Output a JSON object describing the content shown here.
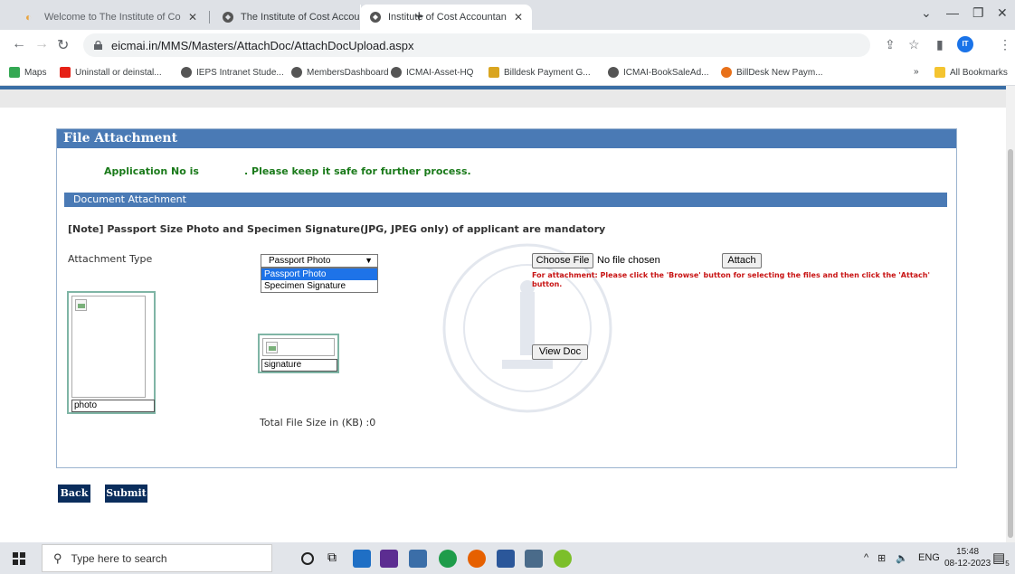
{
  "browser": {
    "tabs": [
      {
        "title": "Welcome to The Institute of Cos"
      },
      {
        "title": "The Institute of Cost Accountant"
      },
      {
        "title": "Institute of Cost Accountants of"
      }
    ],
    "address": "eicmai.in/MMS/Masters/AttachDoc/AttachDocUpload.aspx",
    "profile_initials": "IT",
    "bookmarks": [
      "Maps",
      "Uninstall or deinstal...",
      "IEPS Intranet Stude...",
      "MembersDashboard",
      "ICMAI-Asset-HQ",
      "Billdesk Payment G...",
      "ICMAI-BookSaleAd...",
      "BillDesk New Paym...",
      "All Bookmarks"
    ],
    "overflow": "»"
  },
  "page": {
    "header": "File Attachment",
    "app_no_label": "Application No is",
    "app_no_message": ". Please keep it safe for further process.",
    "section": "Document Attachment",
    "note": "[Note] Passport Size Photo and Specimen Signature(JPG, JPEG only) of applicant are mandatory",
    "attachment_type_label": "Attachment Type",
    "select_value": "Passport Photo",
    "options": [
      "Passport Photo",
      "Specimen Signature"
    ],
    "choose_file": "Choose File",
    "no_file": "No file chosen",
    "attach": "Attach",
    "hint": "For attachment: Please click the 'Browse' button for selecting the files and then click the 'Attach' button.",
    "photo_label": "photo",
    "signature_label": "signature",
    "view_doc": "View Doc",
    "total_size": "Total File Size in (KB) :0",
    "back": "Back",
    "submit": "Submit"
  },
  "taskbar": {
    "search_placeholder": "Type here to search",
    "lang": "ENG",
    "time": "15:48",
    "date": "08-12-2023",
    "notif_count": "5"
  }
}
